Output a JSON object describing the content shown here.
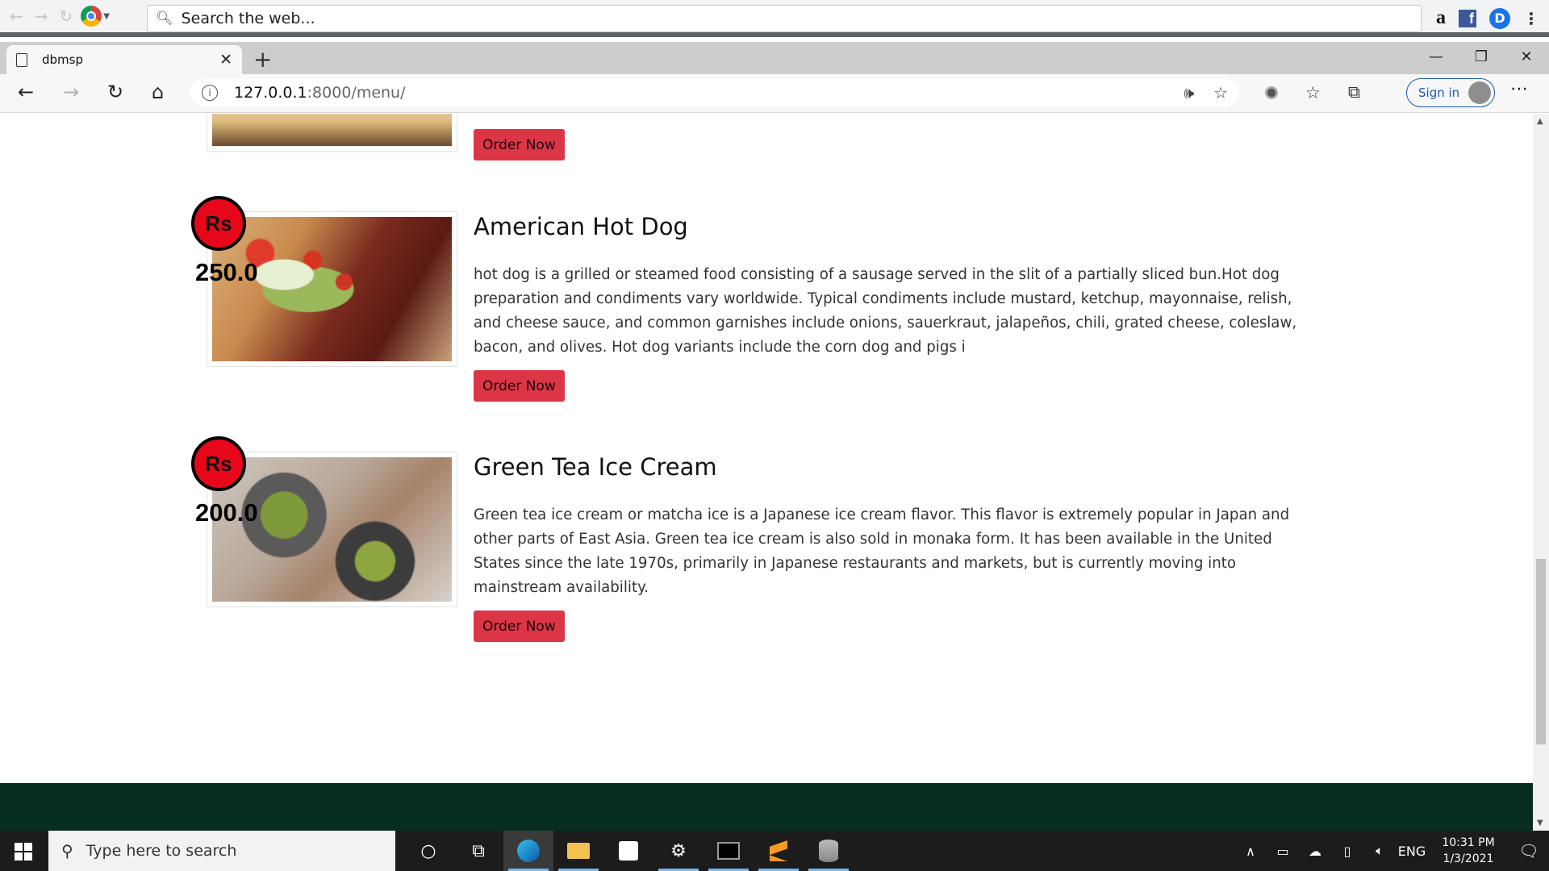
{
  "outer_browser": {
    "search_placeholder": "Search the web...",
    "extensions": [
      "a",
      "f",
      "D"
    ]
  },
  "edge": {
    "tab_title": "dbmsp",
    "url_host": "127.0.0.1",
    "url_path": ":8000/menu/",
    "signin_label": "Sign in"
  },
  "menu": {
    "currency": "Rs",
    "order_label": "Order Now",
    "items": [
      {
        "title": "American Hot Dog",
        "price": "250.0",
        "description": "hot dog is a grilled or steamed food consisting of a sausage served in the slit of a partially sliced bun.Hot dog preparation and condiments vary worldwide. Typical condiments include mustard, ketchup, mayonnaise, relish, and cheese sauce, and common garnishes include onions, sauerkraut, jalapeños, chili, grated cheese, coleslaw, bacon, and olives. Hot dog variants include the corn dog and pigs i"
      },
      {
        "title": "Green Tea Ice Cream",
        "price": "200.0",
        "description": "Green tea ice cream or matcha ice is a Japanese ice cream flavor. This flavor is extremely popular in Japan and other parts of East Asia. Green tea ice cream is also sold in monaka form. It has been available in the United States since the late 1970s, primarily in Japanese restaurants and markets, but is currently moving into mainstream availability."
      }
    ]
  },
  "taskbar": {
    "search_placeholder": "Type here to search",
    "language": "ENG",
    "time": "10:31 PM",
    "date": "1/3/2021"
  }
}
